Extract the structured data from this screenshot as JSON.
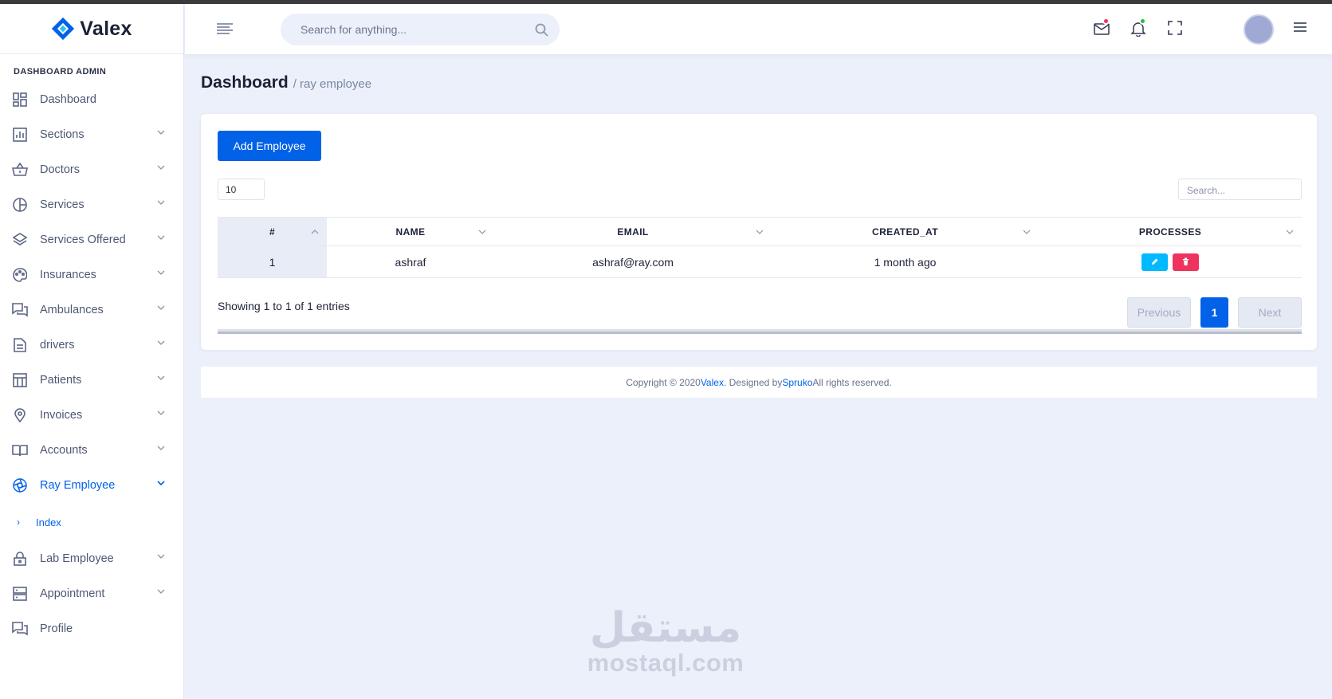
{
  "brand": {
    "name": "Valex"
  },
  "sidebar": {
    "category": "DASHBOARD ADMIN",
    "items": [
      {
        "label": "Dashboard",
        "icon": "dashboard-icon",
        "has_chevron": false
      },
      {
        "label": "Sections",
        "icon": "bar-chart-icon",
        "has_chevron": true
      },
      {
        "label": "Doctors",
        "icon": "basket-icon",
        "has_chevron": true
      },
      {
        "label": "Services",
        "icon": "pie-chart-icon",
        "has_chevron": true
      },
      {
        "label": "Services Offered",
        "icon": "layers-icon",
        "has_chevron": true
      },
      {
        "label": "Insurances",
        "icon": "palette-icon",
        "has_chevron": true
      },
      {
        "label": "Ambulances",
        "icon": "chat-icon",
        "has_chevron": true
      },
      {
        "label": "drivers",
        "icon": "document-icon",
        "has_chevron": true
      },
      {
        "label": "Patients",
        "icon": "table-icon",
        "has_chevron": true
      },
      {
        "label": "Invoices",
        "icon": "map-pin-icon",
        "has_chevron": true
      },
      {
        "label": "Accounts",
        "icon": "book-icon",
        "has_chevron": true
      },
      {
        "label": "Ray Employee",
        "icon": "aperture-icon",
        "has_chevron": true,
        "active": true
      }
    ],
    "sub_items": [
      {
        "label": "Index"
      }
    ],
    "items_after": [
      {
        "label": "Lab Employee",
        "icon": "lock-icon",
        "has_chevron": true
      },
      {
        "label": "Appointment",
        "icon": "server-icon",
        "has_chevron": true
      },
      {
        "label": "Profile",
        "icon": "chat-icon",
        "has_chevron": false
      }
    ]
  },
  "header": {
    "search_placeholder": "Search for anything...",
    "mail_dot_color": "#ee335e",
    "bell_dot_color": "#22c03c"
  },
  "page": {
    "title": "Dashboard",
    "breadcrumb": "/ ray employee"
  },
  "card": {
    "add_button": "Add Employee",
    "page_length": "10",
    "search_placeholder": "Search...",
    "columns": [
      "#",
      "NAME",
      "EMAIL",
      "CREATED_AT",
      "PROCESSES"
    ],
    "rows": [
      {
        "id": "1",
        "name": "ashraf",
        "email": "ashraf@ray.com",
        "created_at": "1 month ago"
      }
    ],
    "info": "Showing 1 to 1 of 1 entries",
    "pagination": {
      "previous": "Previous",
      "current": "1",
      "next": "Next"
    },
    "edit_color": "#00b9ff",
    "delete_color": "#ee335e"
  },
  "footer": {
    "prefix": "Copyright © 2020 ",
    "brand": "Valex",
    "middle": ". Designed by ",
    "designer": "Spruko",
    "suffix": " All rights reserved."
  },
  "watermark": {
    "arabic": "مستقل",
    "latin": "mostaql.com"
  },
  "colors": {
    "primary": "#0162e8",
    "background": "#ecf0fa"
  }
}
